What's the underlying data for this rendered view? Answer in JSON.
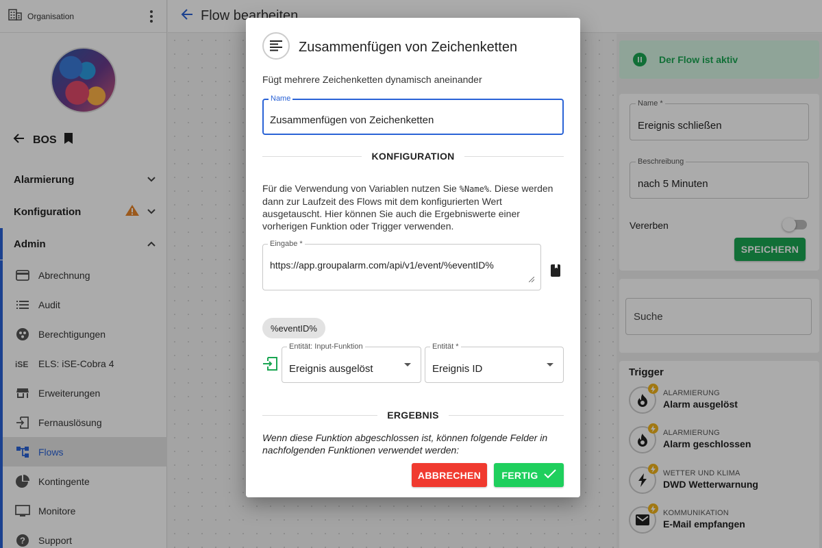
{
  "colors": {
    "primary": "#2962d6",
    "success": "#1aa652",
    "danger": "#f03a2f",
    "warning": "#e8852a"
  },
  "sidebar": {
    "org_label": "Organisation",
    "team_name": "BOS",
    "sections": [
      {
        "label": "Alarmierung"
      },
      {
        "label": "Konfiguration",
        "warning_icon": "warning-icon"
      },
      {
        "label": "Admin"
      }
    ],
    "admin_items": [
      {
        "label": "Abrechnung",
        "icon": "credit-card-icon"
      },
      {
        "label": "Audit",
        "icon": "list-icon"
      },
      {
        "label": "Berechtigungen",
        "icon": "permissions-icon"
      },
      {
        "label": "ELS: iSE-Cobra 4",
        "icon": "ise-logo-icon"
      },
      {
        "label": "Erweiterungen",
        "icon": "store-icon"
      },
      {
        "label": "Fernauslösung",
        "icon": "remote-trigger-icon"
      },
      {
        "label": "Flows",
        "icon": "flows-icon",
        "active": true
      },
      {
        "label": "Kontingente",
        "icon": "pie-chart-icon"
      },
      {
        "label": "Monitore",
        "icon": "monitor-icon"
      },
      {
        "label": "Support",
        "icon": "help-icon"
      }
    ]
  },
  "header": {
    "title": "Flow bearbeiten"
  },
  "right_panel": {
    "status": "Der Flow ist aktiv",
    "name_label": "Name *",
    "name_value": "Ereignis schließen",
    "description_label": "Beschreibung",
    "description_value": "nach 5 Minuten",
    "inherit_label": "Vererben",
    "save_label": "SPEICHERN",
    "search_placeholder": "Suche",
    "trigger_title": "Trigger",
    "triggers": [
      {
        "category": "ALARMIERUNG",
        "name": "Alarm ausgelöst",
        "icon": "fire-icon"
      },
      {
        "category": "ALARMIERUNG",
        "name": "Alarm geschlossen",
        "icon": "fire-icon"
      },
      {
        "category": "WETTER UND KLIMA",
        "name": "DWD Wetterwarnung",
        "icon": "lightning-icon"
      },
      {
        "category": "KOMMUNIKATION",
        "name": "E-Mail empfangen",
        "icon": "mail-icon"
      }
    ]
  },
  "dialog": {
    "title": "Zusammenfügen von Zeichenketten",
    "description": "Fügt mehrere Zeichenketten dynamisch aneinander",
    "name_label": "Name",
    "name_value": "Zusammenfügen von Zeichenketten",
    "config_heading": "KONFIGURATION",
    "config_text_before": "Für die Verwendung von Variablen nutzen Sie ",
    "config_code": "%Name%",
    "config_text_after": ". Diese werden dann zur Laufzeit des Flows mit dem konfigurierten Wert ausgetauscht. Hier können Sie auch die Ergebniswerte einer vorherigen Funktion oder Trigger verwenden.",
    "input_label": "Eingabe *",
    "input_value": "https://app.groupalarm.com/api/v1/event/%eventID%",
    "variable_chip": "%eventID%",
    "entity_input_label": "Entität: Input-Funktion",
    "entity_input_value": "Ereignis ausgelöst",
    "entity_label": "Entität *",
    "entity_value": "Ereignis ID",
    "result_heading": "ERGEBNIS",
    "result_text": "Wenn diese Funktion abgeschlossen ist, können folgende Felder in nachfolgenden Funktionen verwendet werden:",
    "cancel_label": "ABBRECHEN",
    "done_label": "FERTIG"
  }
}
